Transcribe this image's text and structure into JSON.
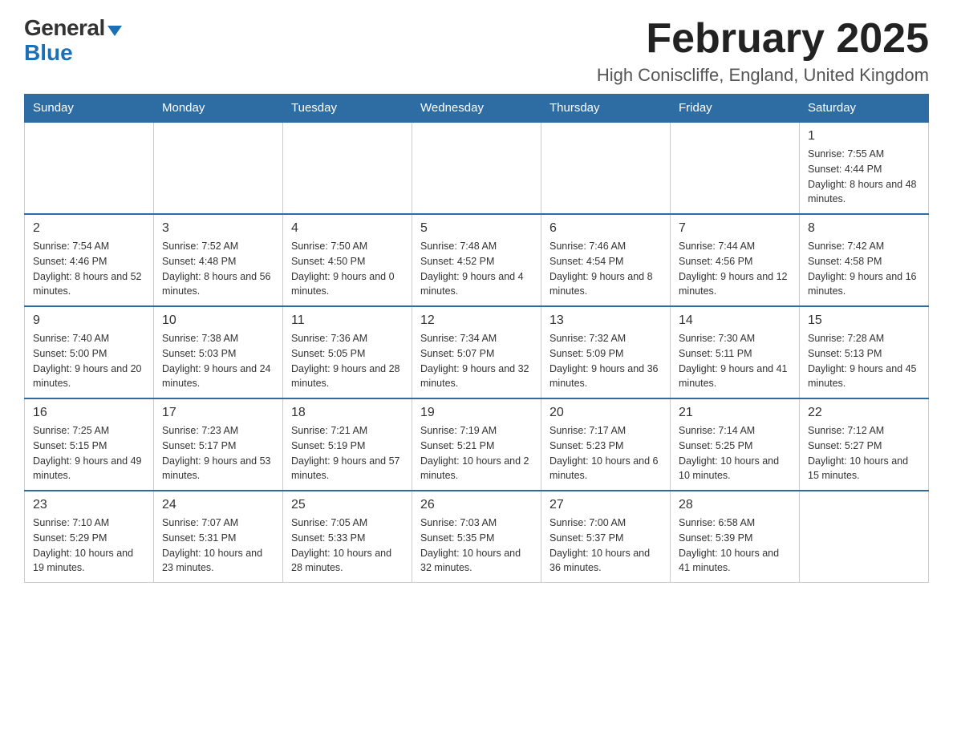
{
  "logo": {
    "general": "General",
    "blue": "Blue"
  },
  "header": {
    "month_title": "February 2025",
    "location": "High Coniscliffe, England, United Kingdom"
  },
  "weekdays": [
    "Sunday",
    "Monday",
    "Tuesday",
    "Wednesday",
    "Thursday",
    "Friday",
    "Saturday"
  ],
  "weeks": [
    [
      {
        "day": "",
        "sunrise": "",
        "sunset": "",
        "daylight": ""
      },
      {
        "day": "",
        "sunrise": "",
        "sunset": "",
        "daylight": ""
      },
      {
        "day": "",
        "sunrise": "",
        "sunset": "",
        "daylight": ""
      },
      {
        "day": "",
        "sunrise": "",
        "sunset": "",
        "daylight": ""
      },
      {
        "day": "",
        "sunrise": "",
        "sunset": "",
        "daylight": ""
      },
      {
        "day": "",
        "sunrise": "",
        "sunset": "",
        "daylight": ""
      },
      {
        "day": "1",
        "sunrise": "Sunrise: 7:55 AM",
        "sunset": "Sunset: 4:44 PM",
        "daylight": "Daylight: 8 hours and 48 minutes."
      }
    ],
    [
      {
        "day": "2",
        "sunrise": "Sunrise: 7:54 AM",
        "sunset": "Sunset: 4:46 PM",
        "daylight": "Daylight: 8 hours and 52 minutes."
      },
      {
        "day": "3",
        "sunrise": "Sunrise: 7:52 AM",
        "sunset": "Sunset: 4:48 PM",
        "daylight": "Daylight: 8 hours and 56 minutes."
      },
      {
        "day": "4",
        "sunrise": "Sunrise: 7:50 AM",
        "sunset": "Sunset: 4:50 PM",
        "daylight": "Daylight: 9 hours and 0 minutes."
      },
      {
        "day": "5",
        "sunrise": "Sunrise: 7:48 AM",
        "sunset": "Sunset: 4:52 PM",
        "daylight": "Daylight: 9 hours and 4 minutes."
      },
      {
        "day": "6",
        "sunrise": "Sunrise: 7:46 AM",
        "sunset": "Sunset: 4:54 PM",
        "daylight": "Daylight: 9 hours and 8 minutes."
      },
      {
        "day": "7",
        "sunrise": "Sunrise: 7:44 AM",
        "sunset": "Sunset: 4:56 PM",
        "daylight": "Daylight: 9 hours and 12 minutes."
      },
      {
        "day": "8",
        "sunrise": "Sunrise: 7:42 AM",
        "sunset": "Sunset: 4:58 PM",
        "daylight": "Daylight: 9 hours and 16 minutes."
      }
    ],
    [
      {
        "day": "9",
        "sunrise": "Sunrise: 7:40 AM",
        "sunset": "Sunset: 5:00 PM",
        "daylight": "Daylight: 9 hours and 20 minutes."
      },
      {
        "day": "10",
        "sunrise": "Sunrise: 7:38 AM",
        "sunset": "Sunset: 5:03 PM",
        "daylight": "Daylight: 9 hours and 24 minutes."
      },
      {
        "day": "11",
        "sunrise": "Sunrise: 7:36 AM",
        "sunset": "Sunset: 5:05 PM",
        "daylight": "Daylight: 9 hours and 28 minutes."
      },
      {
        "day": "12",
        "sunrise": "Sunrise: 7:34 AM",
        "sunset": "Sunset: 5:07 PM",
        "daylight": "Daylight: 9 hours and 32 minutes."
      },
      {
        "day": "13",
        "sunrise": "Sunrise: 7:32 AM",
        "sunset": "Sunset: 5:09 PM",
        "daylight": "Daylight: 9 hours and 36 minutes."
      },
      {
        "day": "14",
        "sunrise": "Sunrise: 7:30 AM",
        "sunset": "Sunset: 5:11 PM",
        "daylight": "Daylight: 9 hours and 41 minutes."
      },
      {
        "day": "15",
        "sunrise": "Sunrise: 7:28 AM",
        "sunset": "Sunset: 5:13 PM",
        "daylight": "Daylight: 9 hours and 45 minutes."
      }
    ],
    [
      {
        "day": "16",
        "sunrise": "Sunrise: 7:25 AM",
        "sunset": "Sunset: 5:15 PM",
        "daylight": "Daylight: 9 hours and 49 minutes."
      },
      {
        "day": "17",
        "sunrise": "Sunrise: 7:23 AM",
        "sunset": "Sunset: 5:17 PM",
        "daylight": "Daylight: 9 hours and 53 minutes."
      },
      {
        "day": "18",
        "sunrise": "Sunrise: 7:21 AM",
        "sunset": "Sunset: 5:19 PM",
        "daylight": "Daylight: 9 hours and 57 minutes."
      },
      {
        "day": "19",
        "sunrise": "Sunrise: 7:19 AM",
        "sunset": "Sunset: 5:21 PM",
        "daylight": "Daylight: 10 hours and 2 minutes."
      },
      {
        "day": "20",
        "sunrise": "Sunrise: 7:17 AM",
        "sunset": "Sunset: 5:23 PM",
        "daylight": "Daylight: 10 hours and 6 minutes."
      },
      {
        "day": "21",
        "sunrise": "Sunrise: 7:14 AM",
        "sunset": "Sunset: 5:25 PM",
        "daylight": "Daylight: 10 hours and 10 minutes."
      },
      {
        "day": "22",
        "sunrise": "Sunrise: 7:12 AM",
        "sunset": "Sunset: 5:27 PM",
        "daylight": "Daylight: 10 hours and 15 minutes."
      }
    ],
    [
      {
        "day": "23",
        "sunrise": "Sunrise: 7:10 AM",
        "sunset": "Sunset: 5:29 PM",
        "daylight": "Daylight: 10 hours and 19 minutes."
      },
      {
        "day": "24",
        "sunrise": "Sunrise: 7:07 AM",
        "sunset": "Sunset: 5:31 PM",
        "daylight": "Daylight: 10 hours and 23 minutes."
      },
      {
        "day": "25",
        "sunrise": "Sunrise: 7:05 AM",
        "sunset": "Sunset: 5:33 PM",
        "daylight": "Daylight: 10 hours and 28 minutes."
      },
      {
        "day": "26",
        "sunrise": "Sunrise: 7:03 AM",
        "sunset": "Sunset: 5:35 PM",
        "daylight": "Daylight: 10 hours and 32 minutes."
      },
      {
        "day": "27",
        "sunrise": "Sunrise: 7:00 AM",
        "sunset": "Sunset: 5:37 PM",
        "daylight": "Daylight: 10 hours and 36 minutes."
      },
      {
        "day": "28",
        "sunrise": "Sunrise: 6:58 AM",
        "sunset": "Sunset: 5:39 PM",
        "daylight": "Daylight: 10 hours and 41 minutes."
      },
      {
        "day": "",
        "sunrise": "",
        "sunset": "",
        "daylight": ""
      }
    ]
  ]
}
